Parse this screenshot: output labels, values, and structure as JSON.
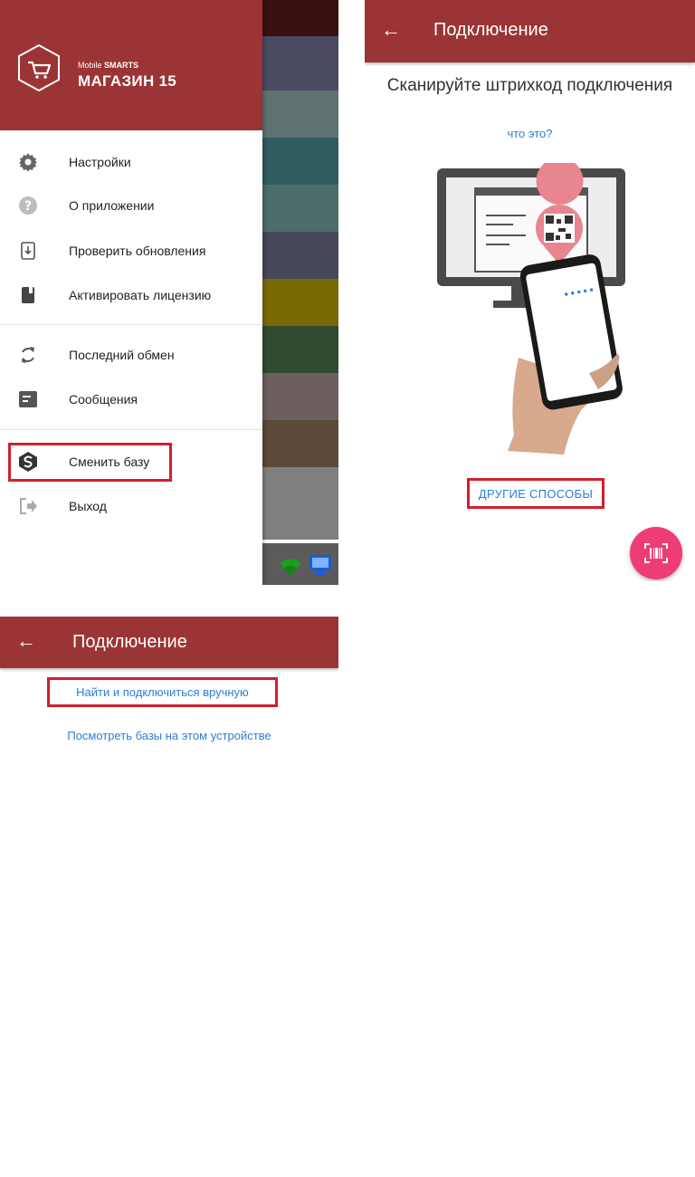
{
  "drawer": {
    "brand_line1": "Mobile",
    "brand_line1_bold": "SMARTS",
    "brand_line2": "МАГАЗИН 15",
    "items": [
      {
        "label": "Настройки",
        "icon": "gear-icon"
      },
      {
        "label": "О приложении",
        "icon": "help-icon"
      },
      {
        "label": "Проверить обновления",
        "icon": "download-update-icon"
      },
      {
        "label": "Активировать лицензию",
        "icon": "license-icon"
      },
      {
        "label": "Последний обмен",
        "icon": "sync-icon"
      },
      {
        "label": "Сообщения",
        "icon": "message-icon"
      },
      {
        "label": "Сменить базу",
        "icon": "switch-base-icon"
      },
      {
        "label": "Выход",
        "icon": "exit-icon"
      }
    ],
    "background_strip_colors": [
      "#3a1010",
      "#4a4a62",
      "#5f7272",
      "#2f5c60",
      "#4c6d6a",
      "#47475c",
      "#7a6a06",
      "#314a32",
      "#6c5f5f",
      "#5d4a3b",
      "#7f7f7f"
    ],
    "status_icons": [
      "wifi-icon",
      "monitor-icon"
    ]
  },
  "scan_screen": {
    "back_icon": "←",
    "title": "Подключение",
    "heading": "Сканируйте штрихкод подключения",
    "what_is_this": "что это?",
    "other_ways": "ДРУГИЕ СПОСОБЫ",
    "fab_icon": "barcode-scan-icon",
    "phone_dots": "•••••"
  },
  "manual_screen": {
    "back_icon": "←",
    "title": "Подключение",
    "find_manual": "Найти и подключиться вручную",
    "view_local": "Посмотреть базы на этом устройстве"
  },
  "colors": {
    "app_bar": "#9b3434",
    "link": "#2b7fd6",
    "highlight": "#d21f2b",
    "fab": "#ee3d75"
  }
}
